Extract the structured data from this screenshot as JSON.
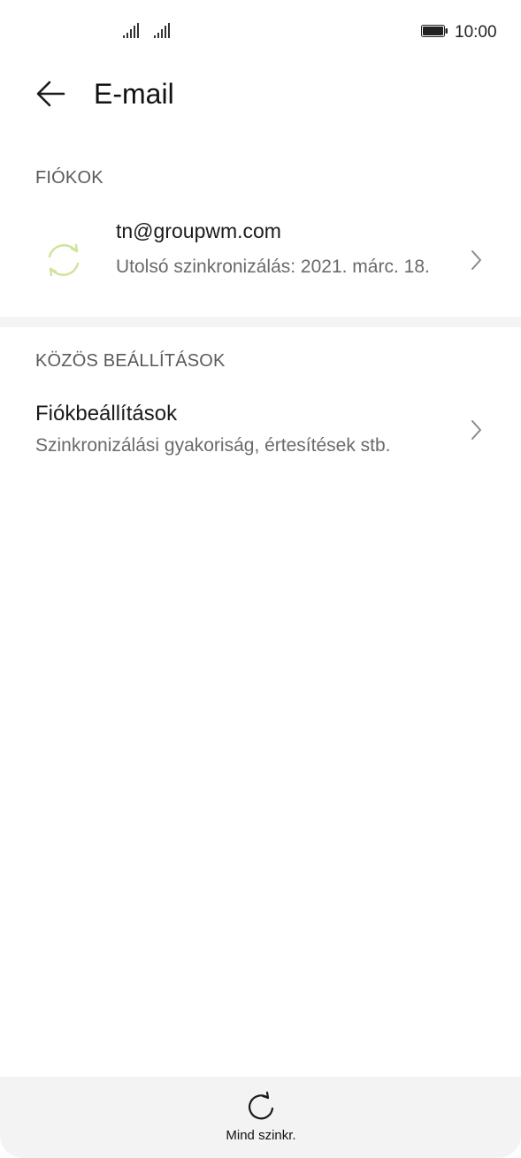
{
  "status_bar": {
    "time": "10:00",
    "icons": [
      "signal-icon",
      "signal-icon",
      "battery-icon"
    ]
  },
  "header": {
    "title": "E-mail",
    "back_icon": "back-arrow-icon"
  },
  "accounts_section": {
    "label": "FIÓKOK",
    "account": {
      "email": "tn@groupwm.com",
      "last_sync": "Utolsó szinkronizálás: 2021. márc. 18.",
      "icon": "sync-icon",
      "icon_color": "#cfe39a"
    }
  },
  "common_settings_section": {
    "label": "KÖZÖS BEÁLLÍTÁSOK",
    "item": {
      "title": "Fiókbeállítások",
      "subtitle": "Szinkronizálási gyakoriság, értesítések stb."
    }
  },
  "bottom_bar": {
    "sync_all_label": "Mind szinkr.",
    "sync_all_icon": "refresh-icon"
  }
}
